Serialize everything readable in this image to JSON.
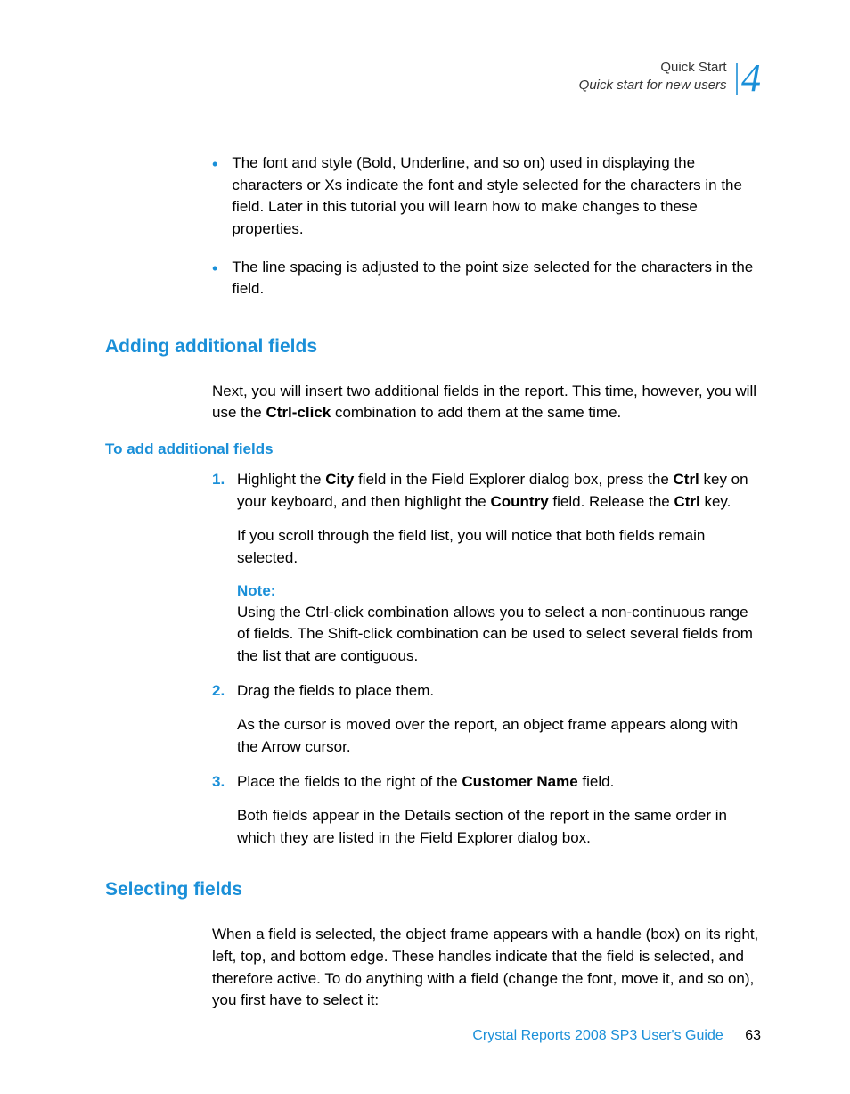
{
  "header": {
    "top": "Quick Start",
    "bottom": "Quick start for new users",
    "chapter": "4"
  },
  "bullets": [
    "The font and style (Bold, Underline, and so on) used in displaying the characters or Xs indicate the font and style selected for the characters in the field. Later in this tutorial you will learn how to make changes to these properties.",
    "The line spacing is adjusted to the point size selected for the characters in the field."
  ],
  "section1": {
    "heading": "Adding additional fields",
    "intro_pre": "Next, you will insert two additional fields in the report. This time, however, you will use the ",
    "intro_bold": "Ctrl-click",
    "intro_post": " combination to add them at the same time."
  },
  "sub1": {
    "heading": "To add additional fields",
    "step1": {
      "num": "1.",
      "t1": "Highlight the ",
      "b1": "City",
      "t2": " field in the Field Explorer dialog box, press the ",
      "b2": "Ctrl",
      "t3": " key on your keyboard, and then highlight the ",
      "b3": "Country",
      "t4": " field. Release the ",
      "b4": "Ctrl",
      "t5": " key."
    },
    "step1_sub": "If you scroll through the field list, you will notice that both fields remain selected.",
    "note_label": "Note:",
    "note_text": "Using the Ctrl-click combination allows you to select a non-continuous range of fields. The Shift-click combination can be used to select several fields from the list that are contiguous.",
    "step2": {
      "num": "2.",
      "text": "Drag the fields to place them."
    },
    "step2_sub": "As the cursor is moved over the report, an object frame appears along with the Arrow cursor.",
    "step3": {
      "num": "3.",
      "t1": "Place the fields to the right of the ",
      "b1": "Customer Name",
      "t2": " field."
    },
    "step3_sub": "Both fields appear in the Details section of the report in the same order in which they are listed in the Field Explorer dialog box."
  },
  "section2": {
    "heading": "Selecting fields",
    "para": "When a field is selected, the object frame appears with a handle (box) on its right, left, top, and bottom edge. These handles indicate that the field is selected, and therefore active. To do anything with a field (change the font, move it, and so on), you first have to select it:"
  },
  "footer": {
    "title": "Crystal Reports 2008 SP3 User's Guide",
    "page": "63"
  }
}
